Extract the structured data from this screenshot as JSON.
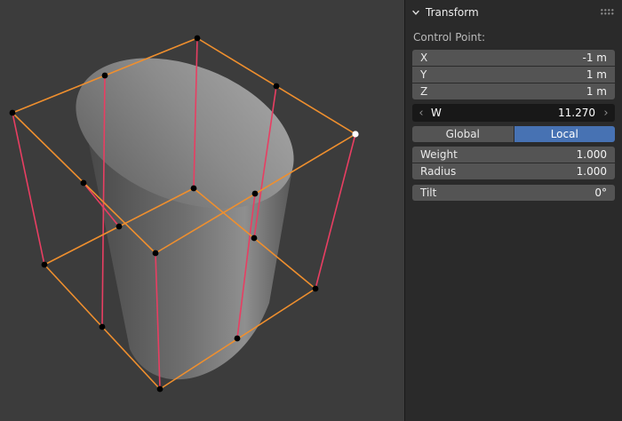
{
  "viewport": {
    "bg": "#3c3c3c",
    "colors": {
      "cage_orange": "#ef8f2e",
      "wire_pink": "#e83e62",
      "point_black": "#000000",
      "point_selected": "#ffffff"
    }
  },
  "panel": {
    "title": "Transform",
    "section_label": "Control Point:",
    "accent_blue": "#4772b3",
    "fields": [
      {
        "label": "X",
        "value": "-1 m"
      },
      {
        "label": "Y",
        "value": "1 m"
      },
      {
        "label": "Z",
        "value": "1 m"
      }
    ],
    "w_field": {
      "label": "W",
      "value": "11.270",
      "left_arrow": "‹",
      "right_arrow": "›"
    },
    "toggle": {
      "options": [
        {
          "label": "Global",
          "active": false
        },
        {
          "label": "Local",
          "active": true
        }
      ]
    },
    "sliders": [
      {
        "label": "Weight",
        "value": "1.000"
      },
      {
        "label": "Radius",
        "value": "1.000"
      },
      {
        "label": "Tilt",
        "value": "0°"
      }
    ]
  }
}
